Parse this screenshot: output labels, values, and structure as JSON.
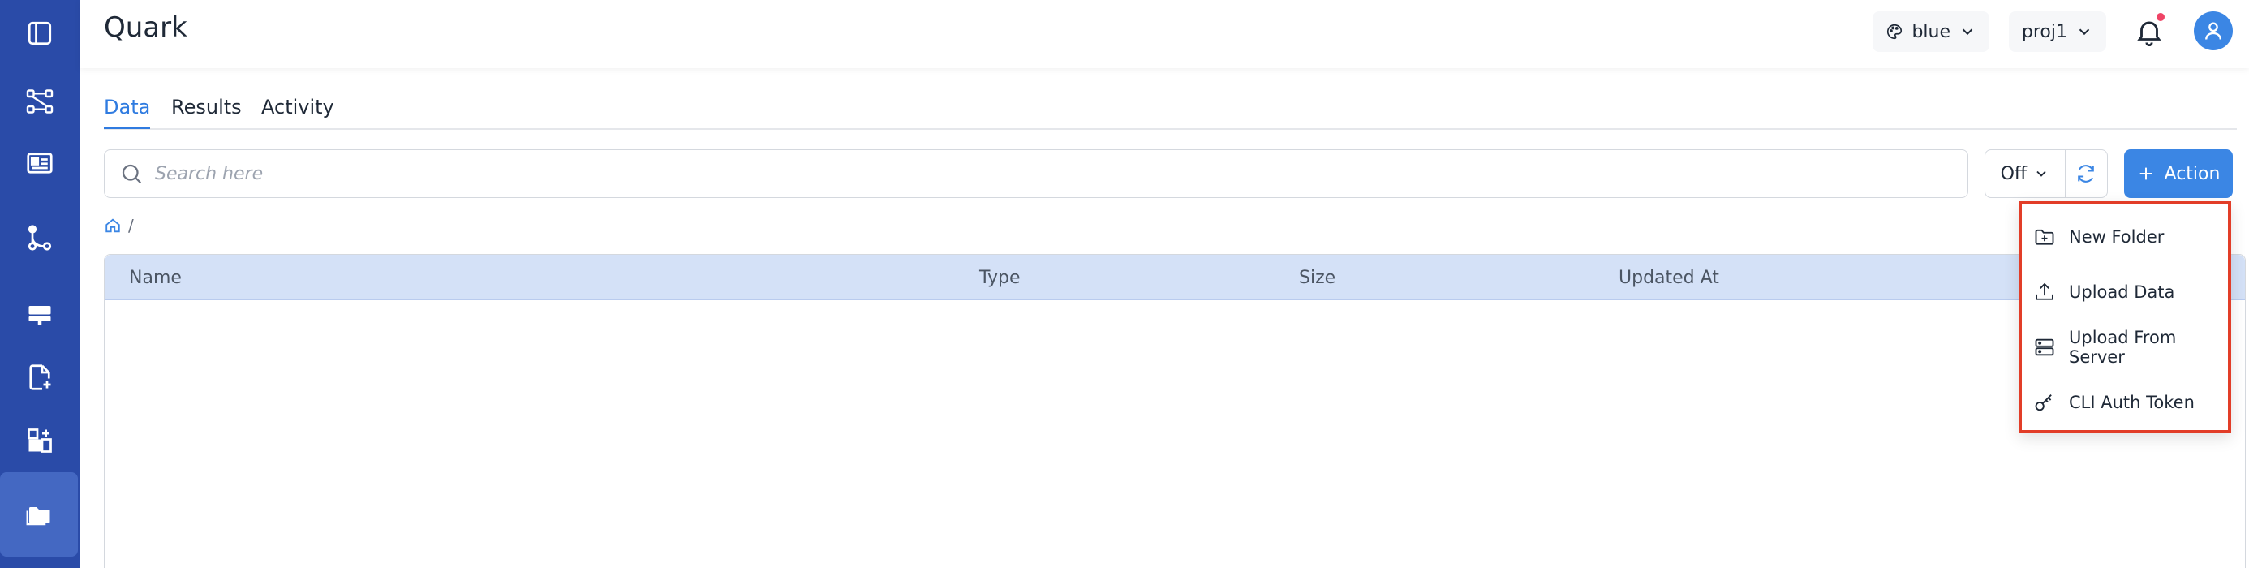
{
  "app": {
    "title": "Quark"
  },
  "sidebar": {
    "items": [
      {
        "icon": "sidebar-toggle-icon"
      },
      {
        "icon": "graph-nodes-icon"
      },
      {
        "icon": "card-icon"
      },
      {
        "icon": "pipeline-icon"
      },
      {
        "icon": "server-icon"
      },
      {
        "icon": "file-add-icon"
      },
      {
        "icon": "apps-add-icon"
      },
      {
        "icon": "folder-icon",
        "active": true
      }
    ]
  },
  "header": {
    "theme_select": {
      "value": "blue"
    },
    "project_select": {
      "value": "proj1"
    }
  },
  "tabs": [
    {
      "label": "Data",
      "active": true
    },
    {
      "label": "Results"
    },
    {
      "label": "Activity"
    }
  ],
  "search": {
    "placeholder": "Search here"
  },
  "toolbar": {
    "off_select": "Off",
    "action_label": "Action"
  },
  "breadcrumb": {
    "separator": "/"
  },
  "table": {
    "columns": [
      "Name",
      "Type",
      "Size",
      "Updated At"
    ]
  },
  "action_menu": {
    "items": [
      {
        "label": "New Folder",
        "icon": "folder-add-icon"
      },
      {
        "label": "Upload Data",
        "icon": "upload-icon"
      },
      {
        "label": "Upload From Server",
        "icon": "server-icon"
      },
      {
        "label": "CLI Auth Token",
        "icon": "key-icon"
      }
    ]
  },
  "colors": {
    "sidebar": "#2a4ba8",
    "sidebar_active": "#4468c2",
    "accent": "#3b86e4",
    "table_header": "#d4e1f7",
    "highlight_border": "#e23d28",
    "notification_dot": "#ef4466"
  }
}
